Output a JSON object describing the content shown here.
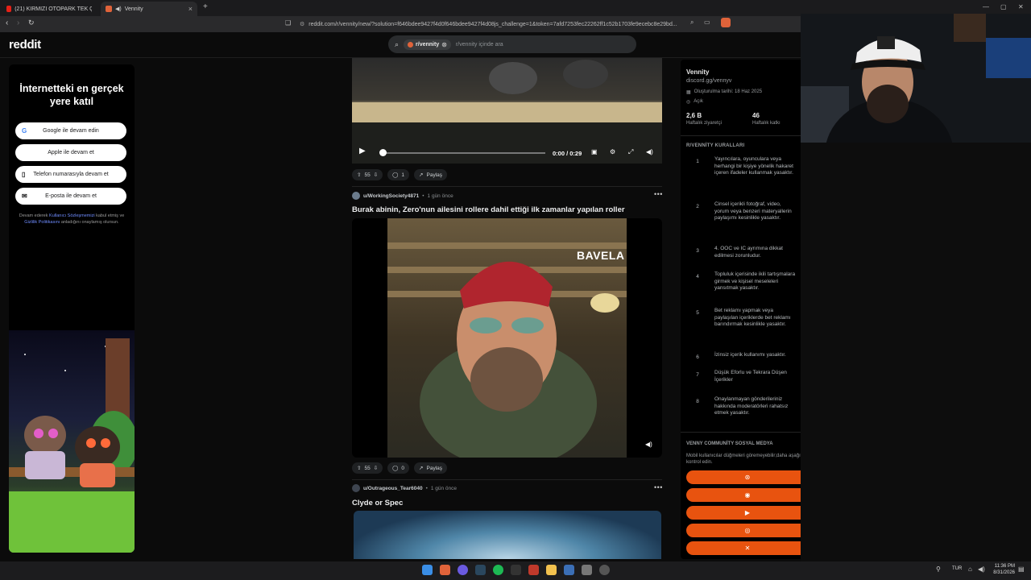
{
  "browser": {
    "tabs": [
      {
        "title": "(21) KIRMIZI OTOPARK TEK ÇIKIŞ YO",
        "active": false
      },
      {
        "title": "Vennity",
        "active": true
      }
    ],
    "url": "reddit.com/r/vennity/new/?solution=f646bdee9427f4d0f646bdee9427f4d08js_challenge=1&token=7afd7253fec22262ff1c52b1703fe9ecebc8e29bd...",
    "new_tab": "+"
  },
  "header": {
    "logo": "reddit",
    "search_chip": "r/vennity",
    "search_placeholder": "r/vennity içinde ara"
  },
  "login_panel": {
    "title": "İnternetteki en gerçek yere katıl",
    "buttons": [
      {
        "label": "Google ile devam edin",
        "icon": "google-icon"
      },
      {
        "label": "Apple ile devam et",
        "icon": "apple-icon"
      },
      {
        "label": "Telefon numarasıyla devam et",
        "icon": "phone-icon"
      },
      {
        "label": "E-posta ile devam et",
        "icon": "mail-icon"
      }
    ],
    "legal_prefix": "Devam ederek",
    "legal_link1": "Kullanıcı Sözleşmemizi",
    "legal_mid": "kabul etmiş ve",
    "legal_link2": "Gizlilik Politikasını",
    "legal_suffix": "anladığını onaylamış olursun."
  },
  "feed": {
    "video1": {
      "time": "0:00 / 0:29",
      "progress": 0.0,
      "upvotes": "55",
      "comments": "1",
      "share": "Paylaş"
    },
    "post2": {
      "user": "u/WorkingSociety4871",
      "time": "1 gün önce",
      "title": "Burak abinin, Zero'nun ailesini rollere dahil ettiği ilk zamanlar yapılan roller",
      "overlay_text": "BAVELA",
      "upvotes": "55",
      "comments": "0",
      "share": "Paylaş"
    },
    "post3": {
      "user": "u/Outrageous_Tear6040",
      "time": "1 gün önce",
      "title": "Clyde or Spec"
    }
  },
  "sidebar": {
    "name": "Vennity",
    "link": "discord.gg/vennyv",
    "created": "Oluşturulma tarihi: 18 Haz 2025",
    "visibility": "Açık",
    "stats": [
      {
        "value": "2,6 B",
        "label": "Haftalık ziyaretçi"
      },
      {
        "value": "46",
        "label": "Haftalık katkı"
      }
    ],
    "rules_title": "R/VENNİTY KURALLARI",
    "rules": [
      {
        "num": "1",
        "text": "Yayıncılara, oyunculara veya herhangi bir kişiye yönelik hakaret içeren ifadeler kullanmak yasaktır."
      },
      {
        "num": "2",
        "text": "Cinsel içerikli fotoğraf, video, yorum veya benzeri materyallerin paylaşımı kesinlikle yasaktır."
      },
      {
        "num": "3",
        "text": "4. OOC ve IC ayrımına dikkat edilmesi zorunludur."
      },
      {
        "num": "4",
        "text": "Topluluk içerisinde ikili tartışmalara girmek ve kişisel meseleleri yansıtmak yasaktır."
      },
      {
        "num": "5",
        "text": "Bet reklamı yapmak veya paylaşılan içeriklerde bet reklamı barındırmak kesinlikle yasaktır."
      },
      {
        "num": "6",
        "text": "İzinsiz içerik kullanımı yasaktır."
      },
      {
        "num": "7",
        "text": "Düşük Eforlu ve Tekrara Düşen İçerikler"
      },
      {
        "num": "8",
        "text": "Onaylanmayan gönderileriniz hakkında moderatörleri rahatsız etmek yasaktır."
      }
    ],
    "social_title": "VENNY COMMUNİTY SOSYAL MEDYA",
    "social_note": "Mobil kullanıcılar düğmeleri göremeyebilir;daha aşağıyı kontrol edin.",
    "social_buttons": [
      "web-icon",
      "discord-icon",
      "youtube-icon",
      "instagram-icon",
      "x-icon"
    ],
    "accent": "#e8530f"
  },
  "taskbar": {
    "lang": "TUR",
    "time": "11:36 PM",
    "date": "8/31/2026"
  }
}
